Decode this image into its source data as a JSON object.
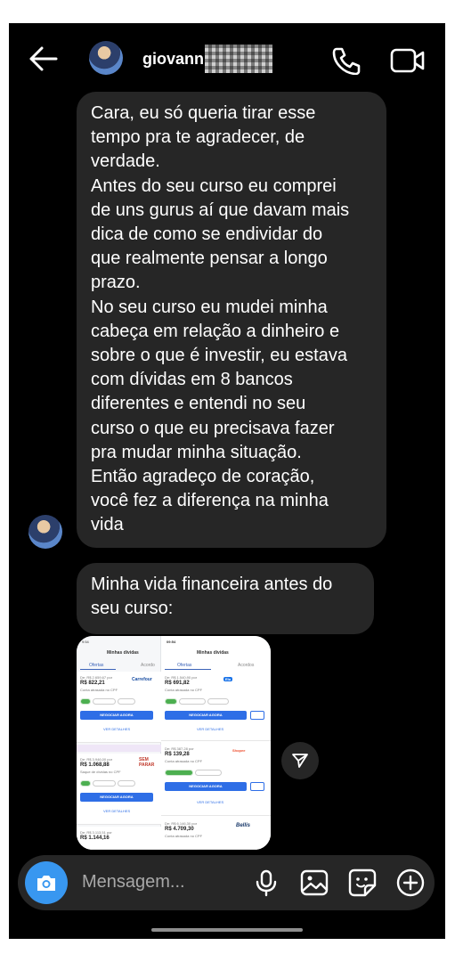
{
  "header": {
    "contact_name": "giovanni",
    "back_icon": "arrow-left-icon",
    "call_icon": "phone-icon",
    "video_icon": "video-camera-icon"
  },
  "messages": [
    {
      "lines": [
        "Cara, eu só queria tirar esse",
        "tempo pra te agradecer, de",
        "verdade.",
        "Antes do seu curso eu comprei",
        "de uns gurus aí que davam mais",
        "dica de como se endividar do",
        "que realmente pensar a longo",
        "prazo.",
        "No seu curso eu mudei minha",
        "cabeça em relação a dinheiro e",
        "sobre o que é investir, eu estava",
        "com dívidas em 8 bancos",
        "diferentes e entendi no seu",
        "curso o que eu precisava fazer",
        "pra mudar minha situação.",
        "Então agradeço de coração,",
        "você fez a diferença na minha",
        "vida"
      ]
    },
    {
      "lines": [
        "Minha vida financeira antes do",
        "seu curso:"
      ]
    }
  ],
  "shared_image": {
    "left": {
      "status_time": "9:54",
      "title": "Minhas dívidas",
      "tab_active": "Ofertas",
      "tab_other": "Acordo",
      "cards": [
        {
          "from": "De: R$ 2.659,67 por",
          "price": "R$ 822,21",
          "note": "Conta atrasada no CPF",
          "brand": "Carrefour",
          "button": "NEGOCIAR AGORA",
          "link": "VER DETALHES"
        },
        {
          "from": "De: R$ 3.946,00 por",
          "price": "R$ 1.068,88",
          "note": "Saque de dívidas no CPF",
          "brand": "SEM PARAR",
          "button": "NEGOCIAR AGORA",
          "link": "VER DETALHES"
        },
        {
          "from": "De: R$ 3.113,51 por",
          "price": "R$ 1.144,16",
          "note": "",
          "brand": "",
          "button": "",
          "link": ""
        }
      ]
    },
    "right": {
      "status_time": "09:54",
      "title": "Minhas dívidas",
      "tab_active": "Ofertas",
      "tab_other": "Acordos",
      "cards": [
        {
          "from": "De: R$ 1.540,90 por",
          "price": "R$ 691,82",
          "note": "Conta atrasada no CPF",
          "brand": "Elo",
          "button": "NEGOCIAR AGORA",
          "link": "VER DETALHES"
        },
        {
          "from": "De: R$ 387,28 por",
          "price": "R$ 139,28",
          "note": "Conta atrasada no CPF",
          "brand": "Shopee",
          "button": "NEGOCIAR AGORA",
          "link": "VER DETALHES"
        },
        {
          "from": "De: R$ 6.146,30 por",
          "price": "R$ 4.709,30",
          "note": "Conta atrasada no CPF",
          "brand": "Bellis",
          "button": "",
          "link": ""
        }
      ]
    }
  },
  "composer": {
    "placeholder": "Mensagem...",
    "camera_icon": "camera-icon",
    "mic_icon": "microphone-icon",
    "gallery_icon": "image-icon",
    "sticker_icon": "sticker-icon",
    "plus_icon": "plus-circle-icon"
  },
  "colors": {
    "background": "#000000",
    "bubble": "#262626",
    "accent": "#3897f0"
  }
}
